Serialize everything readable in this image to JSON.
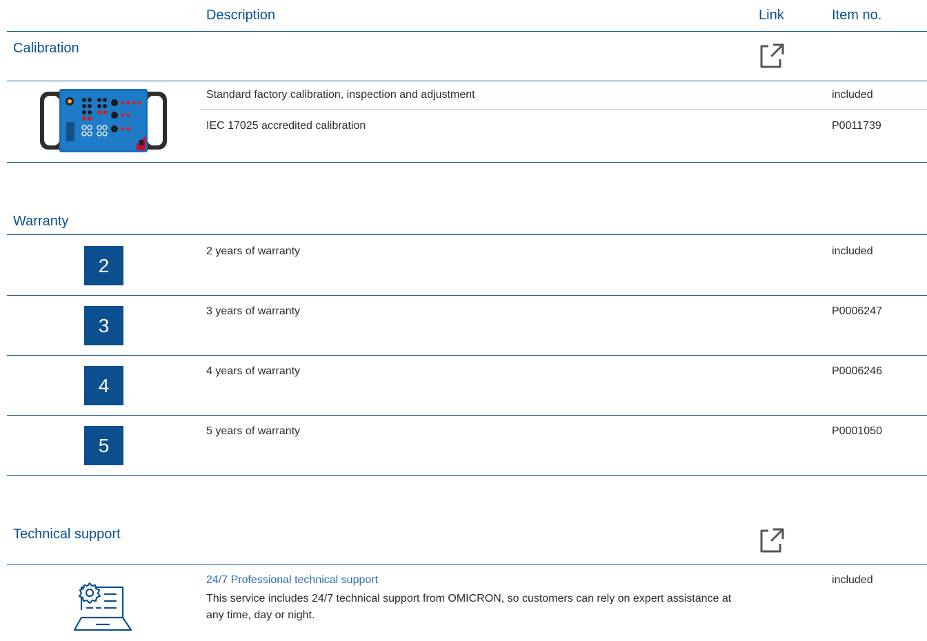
{
  "header": {
    "description": "Description",
    "link": "Link",
    "item_no": "Item no."
  },
  "calibration": {
    "title": "Calibration",
    "rows": [
      {
        "description": "Standard factory calibration, inspection and adjustment",
        "item": "included"
      },
      {
        "description": "IEC 17025 accredited calibration",
        "item": "P0011739"
      }
    ]
  },
  "warranty": {
    "title": "Warranty",
    "rows": [
      {
        "badge": "2",
        "description": "2 years of warranty",
        "item": "included"
      },
      {
        "badge": "3",
        "description": "3 years of warranty",
        "item": "P0006247"
      },
      {
        "badge": "4",
        "description": "4 years of warranty",
        "item": "P0006246"
      },
      {
        "badge": "5",
        "description": "5 years of warranty",
        "item": "P0001050"
      }
    ]
  },
  "support": {
    "title": "Technical support",
    "row": {
      "link_title": "24/7 Professional technical support",
      "description": "This service includes 24/7 technical support from OMICRON, so customers can rely on expert assistance at any time, day or night.",
      "item": "included"
    }
  },
  "icons": {
    "external_link": "external-link-icon",
    "device": "test-device-image",
    "support": "laptop-gear-support-icon"
  },
  "colors": {
    "accent": "#0b4f8f",
    "link": "#2a6bb0",
    "divider_light": "#b7cbe0"
  }
}
